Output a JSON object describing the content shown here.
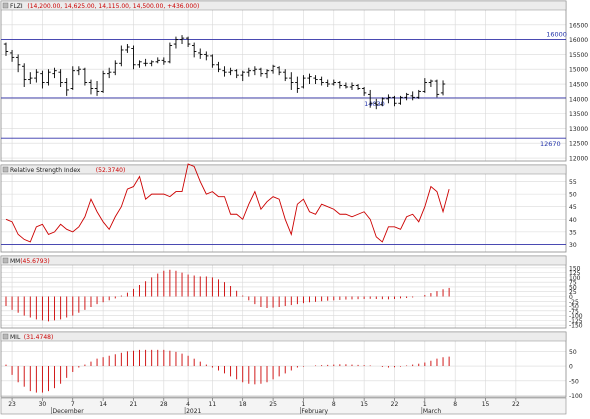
{
  "chart_data": {
    "type": "financial-multi-panel",
    "colors": {
      "background": "#ffffff",
      "grid": "#d9d9d9",
      "border": "#8a8a8a",
      "header": "#ececec",
      "header_text": "#1a1a1a",
      "header_value": "#cc0000",
      "price_bars": "#000000",
      "rsi_line": "#cc0000",
      "histogram": "#cc0000",
      "hline": "#3333aa",
      "hline_label": "#2233aa"
    },
    "time_axis": {
      "tick_labels": [
        {
          "i": 1,
          "label": "23"
        },
        {
          "i": 6,
          "label": "30"
        },
        {
          "i": 11,
          "label": "7"
        },
        {
          "i": 16,
          "label": "14"
        },
        {
          "i": 21,
          "label": "21"
        },
        {
          "i": 26,
          "label": "28"
        },
        {
          "i": 30,
          "label": "4"
        },
        {
          "i": 34,
          "label": "11"
        },
        {
          "i": 39,
          "label": "18"
        },
        {
          "i": 44,
          "label": "25"
        },
        {
          "i": 49,
          "label": "1"
        },
        {
          "i": 54,
          "label": "8"
        },
        {
          "i": 59,
          "label": "15"
        },
        {
          "i": 64,
          "label": "22"
        },
        {
          "i": 69,
          "label": "1"
        },
        {
          "i": 74,
          "label": "8"
        },
        {
          "i": 79,
          "label": "15"
        },
        {
          "i": 84,
          "label": "22"
        }
      ],
      "month_labels": [
        {
          "i": 8,
          "label": "December"
        },
        {
          "i": 30,
          "label": "2021"
        },
        {
          "i": 49,
          "label": "February"
        },
        {
          "i": 69,
          "label": "March"
        }
      ],
      "xmax": 86
    },
    "price": {
      "header_label": "FLZI",
      "header_value": "(14,200.00, 14,625.00, 14,115.00, 14,500.00, +436.000)",
      "ylim": [
        11900,
        17000
      ],
      "yticks": [
        12000,
        12500,
        13000,
        13500,
        14000,
        14500,
        15000,
        15500,
        16000,
        16500
      ],
      "hlines": [
        {
          "value": 16000,
          "label": "16000"
        },
        {
          "value": 14030,
          "label": "14030"
        },
        {
          "value": 12670,
          "label": "12670"
        }
      ],
      "ohlc": [
        [
          15850,
          15900,
          15450,
          15600
        ],
        [
          15550,
          15650,
          15250,
          15400
        ],
        [
          15400,
          15500,
          14900,
          15150
        ],
        [
          15100,
          15200,
          14400,
          14650
        ],
        [
          14650,
          14900,
          14500,
          14700
        ],
        [
          14700,
          15000,
          14550,
          14900
        ],
        [
          14850,
          14950,
          14350,
          14550
        ],
        [
          14550,
          15000,
          14450,
          14900
        ],
        [
          14850,
          15050,
          14700,
          14950
        ],
        [
          14900,
          15000,
          14400,
          14550
        ],
        [
          14550,
          14700,
          14100,
          14300
        ],
        [
          14350,
          15100,
          14300,
          14950
        ],
        [
          14950,
          15100,
          14800,
          15000
        ],
        [
          15000,
          15050,
          14450,
          14550
        ],
        [
          14550,
          14650,
          14150,
          14350
        ],
        [
          14350,
          14600,
          14100,
          14250
        ],
        [
          14250,
          14950,
          14200,
          14850
        ],
        [
          14850,
          15050,
          14700,
          14900
        ],
        [
          14900,
          15300,
          14800,
          15200
        ],
        [
          15200,
          15800,
          15100,
          15650
        ],
        [
          15650,
          15850,
          15550,
          15750
        ],
        [
          15700,
          15800,
          15000,
          15150
        ],
        [
          15150,
          15300,
          15050,
          15250
        ],
        [
          15200,
          15350,
          15100,
          15200
        ],
        [
          15200,
          15300,
          15100,
          15250
        ],
        [
          15250,
          15400,
          15200,
          15300
        ],
        [
          15300,
          15400,
          15150,
          15250
        ],
        [
          15250,
          15900,
          15200,
          15800
        ],
        [
          15850,
          16100,
          15700,
          16000
        ],
        [
          16000,
          16150,
          15850,
          16050
        ],
        [
          16050,
          16100,
          15750,
          15850
        ],
        [
          15800,
          15900,
          15400,
          15600
        ],
        [
          15550,
          15700,
          15350,
          15500
        ],
        [
          15500,
          15600,
          15300,
          15450
        ],
        [
          15450,
          15500,
          15050,
          15150
        ],
        [
          15150,
          15250,
          14900,
          15000
        ],
        [
          14950,
          15100,
          14750,
          14900
        ],
        [
          14900,
          15050,
          14800,
          14950
        ],
        [
          14950,
          15000,
          14700,
          14800
        ],
        [
          14800,
          14950,
          14600,
          14900
        ],
        [
          14900,
          15050,
          14750,
          14950
        ],
        [
          14950,
          15100,
          14800,
          15000
        ],
        [
          15000,
          15050,
          14750,
          14850
        ],
        [
          14850,
          15000,
          14700,
          14950
        ],
        [
          14950,
          15150,
          14850,
          15100
        ],
        [
          15050,
          15100,
          14800,
          14900
        ],
        [
          14900,
          15000,
          14600,
          14700
        ],
        [
          14700,
          14900,
          14300,
          14550
        ],
        [
          14550,
          14750,
          14200,
          14350
        ],
        [
          14400,
          14800,
          14350,
          14700
        ],
        [
          14700,
          14850,
          14500,
          14750
        ],
        [
          14700,
          14800,
          14500,
          14650
        ],
        [
          14650,
          14750,
          14450,
          14550
        ],
        [
          14550,
          14650,
          14400,
          14500
        ],
        [
          14500,
          14650,
          14450,
          14550
        ],
        [
          14550,
          14600,
          14350,
          14450
        ],
        [
          14450,
          14550,
          14350,
          14400
        ],
        [
          14400,
          14550,
          14300,
          14450
        ],
        [
          14450,
          14500,
          14300,
          14350
        ],
        [
          14350,
          14400,
          14100,
          14200
        ],
        [
          14150,
          14300,
          13700,
          13850
        ],
        [
          13850,
          14000,
          13650,
          13800
        ],
        [
          13800,
          14050,
          13750,
          14000
        ],
        [
          14000,
          14150,
          13850,
          14050
        ],
        [
          14050,
          14100,
          13750,
          13850
        ],
        [
          13850,
          14100,
          13800,
          14050
        ],
        [
          14050,
          14200,
          13950,
          14150
        ],
        [
          14100,
          14250,
          13950,
          14050
        ],
        [
          14050,
          14300,
          14000,
          14250
        ],
        [
          14250,
          14700,
          14200,
          14550
        ],
        [
          14550,
          14650,
          14400,
          14600
        ],
        [
          14600,
          14650,
          14050,
          14150
        ],
        [
          14200,
          14625,
          14115,
          14500
        ]
      ]
    },
    "rsi": {
      "header_label": "Relative Strength Index",
      "header_value": "(52.3740)",
      "ylim": [
        27,
        58
      ],
      "yticks": [
        30,
        35,
        40,
        45,
        50,
        55
      ],
      "hline": 30,
      "values": [
        40,
        39,
        34,
        32,
        31,
        37,
        38,
        34,
        35,
        38,
        36,
        35,
        37,
        41,
        48,
        43,
        39,
        36,
        41,
        45,
        52,
        53,
        57,
        48,
        50,
        50,
        50,
        49,
        51,
        51,
        62,
        61,
        55,
        50,
        51,
        49,
        49,
        42,
        42,
        40,
        46,
        51,
        44,
        47,
        49,
        48,
        40,
        34,
        46,
        48,
        43,
        42,
        46,
        45,
        44,
        42,
        42,
        41,
        42,
        43,
        40,
        33,
        31,
        37,
        37,
        36,
        41,
        42,
        39,
        45,
        53,
        51,
        43,
        52
      ]
    },
    "mm": {
      "header_label": "MM",
      "header_value": "(45.6793)",
      "ylim": [
        -165,
        165
      ],
      "yticks": [
        -150,
        -125,
        -100,
        -75,
        -50,
        -25,
        0,
        25,
        50,
        75,
        100,
        125,
        150
      ],
      "values": [
        -50,
        -70,
        -85,
        -100,
        -110,
        -120,
        -125,
        -130,
        -125,
        -120,
        -110,
        -100,
        -85,
        -70,
        -55,
        -40,
        -30,
        -20,
        -10,
        5,
        20,
        40,
        60,
        80,
        100,
        120,
        135,
        140,
        135,
        125,
        115,
        110,
        105,
        105,
        100,
        90,
        75,
        55,
        30,
        5,
        -20,
        -40,
        -55,
        -60,
        -58,
        -55,
        -50,
        -45,
        -40,
        -35,
        -30,
        -28,
        -25,
        -22,
        -20,
        -18,
        -16,
        -15,
        -14,
        -13,
        -12,
        -13,
        -14,
        -15,
        -13,
        -10,
        -8,
        -5,
        0,
        8,
        18,
        28,
        38,
        45
      ]
    },
    "mil": {
      "header_label": "MIL",
      "header_value": "(31.4748)",
      "ylim": [
        -105,
        85
      ],
      "yticks": [
        -100,
        -50,
        0,
        50
      ],
      "values": [
        5,
        -30,
        -55,
        -70,
        -85,
        -90,
        -90,
        -85,
        -75,
        -60,
        -40,
        -20,
        -5,
        5,
        15,
        25,
        30,
        35,
        40,
        45,
        50,
        52,
        55,
        55,
        55,
        55,
        55,
        52,
        48,
        42,
        35,
        25,
        15,
        5,
        -5,
        -15,
        -25,
        -35,
        -45,
        -55,
        -60,
        -62,
        -60,
        -55,
        -45,
        -35,
        -25,
        -15,
        -5,
        -2,
        0,
        2,
        3,
        4,
        5,
        6,
        6,
        5,
        4,
        3,
        2,
        0,
        -3,
        -5,
        -4,
        -2,
        2,
        5,
        8,
        12,
        18,
        25,
        30,
        32
      ]
    }
  }
}
